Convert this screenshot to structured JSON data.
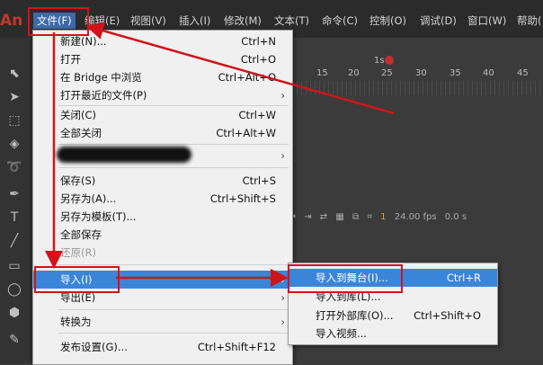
{
  "app": {
    "logo": "An"
  },
  "menubar": {
    "items": [
      "文件(F)",
      "编辑(E)",
      "视图(V)",
      "插入(I)",
      "修改(M)",
      "文本(T)",
      "命令(C)",
      "控制(O)",
      "调试(D)",
      "窗口(W)",
      "帮助("
    ]
  },
  "timeline": {
    "ticks": [
      "1s",
      "15",
      "20",
      "25",
      "30",
      "35",
      "40",
      "45"
    ],
    "fps": "24.00 fps",
    "time": "0.0 s",
    "frame": "1"
  },
  "file_menu": {
    "items": [
      {
        "label": "新建(N)...",
        "shortcut": "Ctrl+N"
      },
      {
        "label": "打开",
        "shortcut": "Ctrl+O"
      },
      {
        "label": "在 Bridge 中浏览",
        "shortcut": "Ctrl+Alt+O"
      },
      {
        "label": "打开最近的文件(P)",
        "shortcut": "",
        "submenu": true
      },
      {
        "label": "关闭(C)",
        "shortcut": "Ctrl+W"
      },
      {
        "label": "全部关闭",
        "shortcut": "Ctrl+Alt+W"
      },
      {
        "label": "",
        "shortcut": "",
        "submenu": true
      },
      {
        "label": "保存(S)",
        "shortcut": "Ctrl+S"
      },
      {
        "label": "另存为(A)...",
        "shortcut": "Ctrl+Shift+S"
      },
      {
        "label": "另存为模板(T)...",
        "shortcut": ""
      },
      {
        "label": "全部保存",
        "shortcut": ""
      },
      {
        "label": "还原(R)",
        "shortcut": ""
      },
      {
        "label": "导入(I)",
        "shortcut": "",
        "submenu": true
      },
      {
        "label": "导出(E)",
        "shortcut": "",
        "submenu": true
      },
      {
        "label": "转换为",
        "shortcut": "",
        "submenu": true
      },
      {
        "label": "发布设置(G)...",
        "shortcut": "Ctrl+Shift+F12"
      }
    ]
  },
  "import_submenu": {
    "items": [
      {
        "label": "导入到舞台(I)...",
        "shortcut": "Ctrl+R"
      },
      {
        "label": "导入到库(L)...",
        "shortcut": ""
      },
      {
        "label": "打开外部库(O)...",
        "shortcut": "Ctrl+Shift+O"
      },
      {
        "label": "导入视频...",
        "shortcut": ""
      }
    ]
  },
  "colors": {
    "highlight": "#3a85d8",
    "annotation": "#d0141a",
    "menubar_active": "#3d6aa8"
  }
}
